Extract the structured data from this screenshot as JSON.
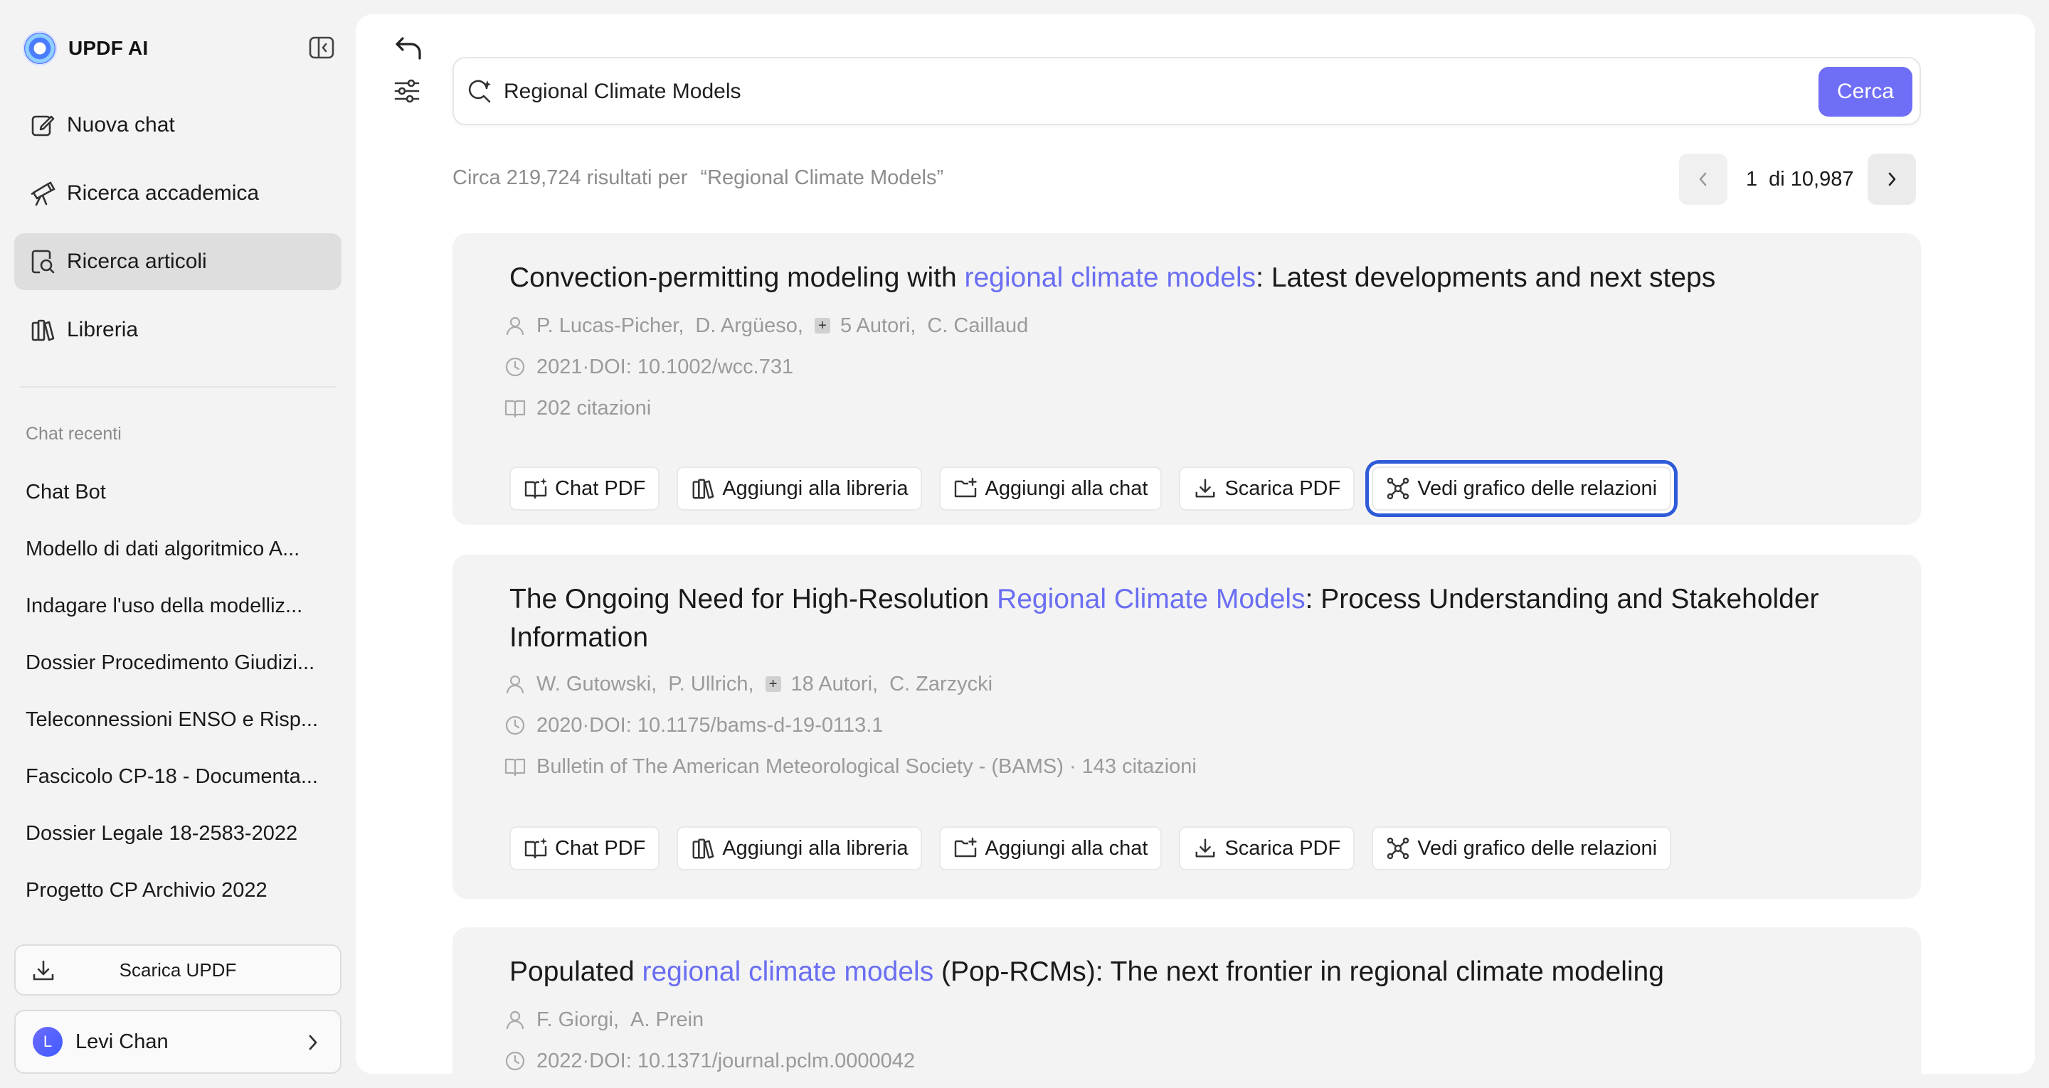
{
  "app": {
    "name": "UPDF AI"
  },
  "sidebar": {
    "nav": [
      {
        "label": "Nuova chat",
        "icon": "edit-icon",
        "active": false
      },
      {
        "label": "Ricerca accademica",
        "icon": "telescope-icon",
        "active": false
      },
      {
        "label": "Ricerca articoli",
        "icon": "search-document-icon",
        "active": true
      },
      {
        "label": "Libreria",
        "icon": "library-icon",
        "active": false
      }
    ],
    "recent_title": "Chat recenti",
    "recent": [
      "Chat Bot",
      "Modello di dati algoritmico A...",
      "Indagare l'uso della modelliz...",
      "Dossier Procedimento Giudizi...",
      "Teleconnessioni ENSO e Risp...",
      "Fascicolo CP-18 - Documenta...",
      "Dossier Legale 18-2583-2022",
      "Progetto CP Archivio 2022"
    ],
    "download_label": "Scarica UPDF",
    "user": {
      "initial": "L",
      "name": "Levi Chan"
    }
  },
  "search": {
    "value": "Regional Climate Models",
    "button_label": "Cerca"
  },
  "results": {
    "summary": "Circa 219,724 risultati per",
    "query_quoted": "“Regional Climate Models”",
    "page_current": "1",
    "page_total": "di 10,987"
  },
  "actions": {
    "chat_pdf": "Chat PDF",
    "add_library": "Aggiungi alla libreria",
    "add_chat": "Aggiungi alla chat",
    "download_pdf": "Scarica PDF",
    "view_graph": "Vedi grafico delle relazioni"
  },
  "papers": [
    {
      "title_pre": "Convection-permitting modeling with ",
      "title_hl": "regional climate models",
      "title_post": ": Latest developments and next steps",
      "author1": "P. Lucas-Picher,",
      "author2": "D. Argüeso,",
      "more_authors": "5 Autori,",
      "author_last": "C. Caillaud",
      "date_doi": "2021·DOI: 10.1002/wcc.731",
      "citations": "202 citazioni"
    },
    {
      "title_pre": "The Ongoing Need for High-Resolution ",
      "title_hl": "Regional Climate Models",
      "title_post": ": Process Understanding and Stakeholder Information",
      "author1": "W. Gutowski,",
      "author2": "P. Ullrich,",
      "more_authors": "18 Autori,",
      "author_last": "C. Zarzycki",
      "date_doi": "2020·DOI: 10.1175/bams-d-19-0113.1",
      "citations": "Bulletin of The American Meteorological Society - (BAMS) · 143 citazioni"
    },
    {
      "title_pre": "Populated ",
      "title_hl": "regional climate models",
      "title_post": " (Pop-RCMs): The next frontier in regional climate modeling",
      "author1": "F. Giorgi,",
      "author2": "A. Prein",
      "date_doi": "2022·DOI: 10.1371/journal.pclm.0000042"
    }
  ],
  "colors": {
    "accent": "#6f6ef7",
    "highlight": "#6a6ef2",
    "focus_ring": "#2f5bd9"
  }
}
